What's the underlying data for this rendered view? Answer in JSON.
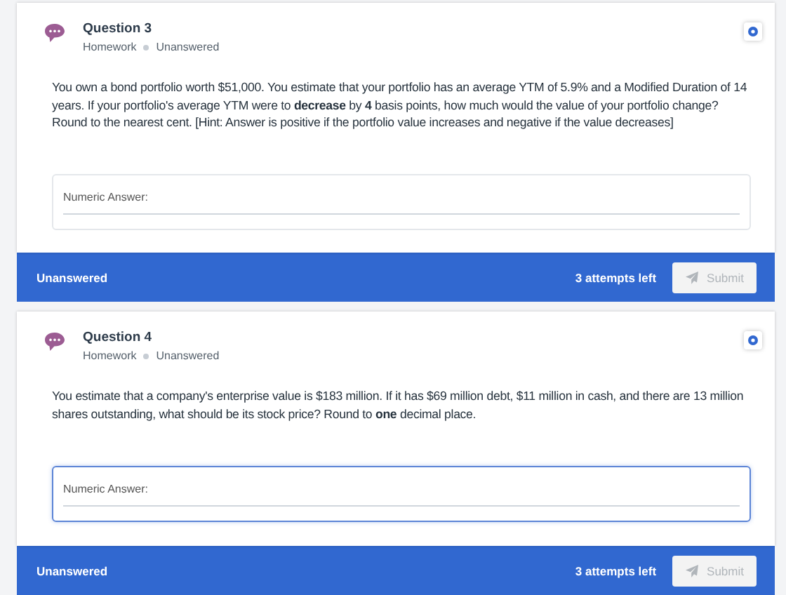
{
  "questions": [
    {
      "title": "Question 3",
      "category": "Homework",
      "status": "Unanswered",
      "text": "You own a bond portfolio worth $51,000. You estimate that your portfolio has an average YTM of 5.9% and a Modified Duration of 14 years. If your portfolio's average YTM were to **decrease** by **4** basis points, how much would the value of your portfolio change? Round to the nearest cent. [Hint: Answer is positive if the portfolio value increases and negative if the value decreases]",
      "answer": {
        "placeholder": "Numeric Answer:",
        "focused": false
      },
      "footer": {
        "status": "Unanswered",
        "attempts": "3 attempts left",
        "submit": {
          "label": "Submit",
          "disabled": true
        }
      }
    },
    {
      "title": "Question 4",
      "category": "Homework",
      "status": "Unanswered",
      "text": "You estimate that a company's enterprise value is $183 million. If it has $69 million debt, $11 million in cash, and there are 13 million shares outstanding, what should be its stock price? Round to **one** decimal place.",
      "answer": {
        "placeholder": "Numeric Answer:",
        "focused": true
      },
      "footer": {
        "status": "Unanswered",
        "attempts": "3 attempts left",
        "submit": {
          "label": "Submit",
          "disabled": true
        }
      }
    }
  ]
}
